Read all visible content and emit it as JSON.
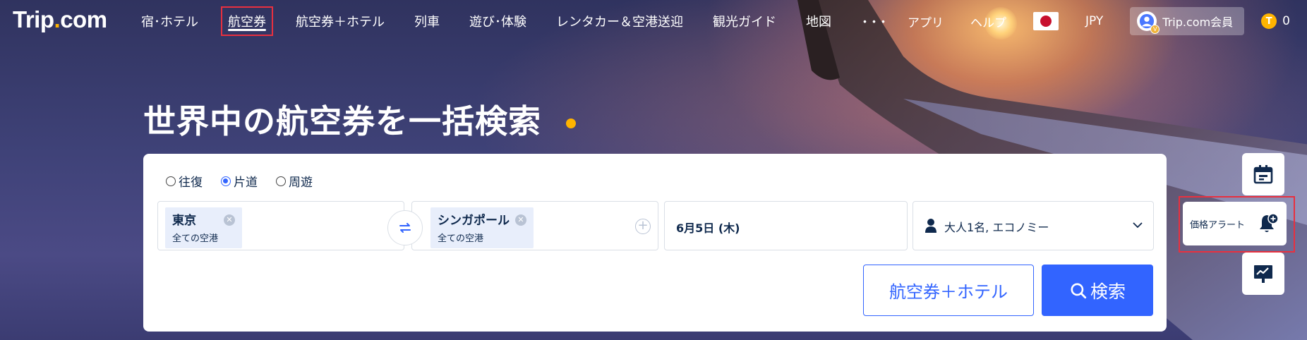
{
  "brand": {
    "logo_main": "Trip",
    "logo_dot": ".",
    "logo_tail": "com"
  },
  "nav": {
    "items": [
      {
        "label": "宿･ホテル"
      },
      {
        "label": "航空券",
        "active": true
      },
      {
        "label": "航空券＋ホテル"
      },
      {
        "label": "列車"
      },
      {
        "label": "遊び･体験"
      },
      {
        "label": "レンタカー＆空港送迎"
      },
      {
        "label": "観光ガイド"
      },
      {
        "label": "地図"
      }
    ],
    "more": "･･･"
  },
  "header_tools": {
    "app": "アプリ",
    "help": "ヘルプ",
    "currency": "JPY",
    "member": "Trip.com会員",
    "coin_letter": "T",
    "coin_count": "0"
  },
  "hero": {
    "title": "世界中の航空券を一括検索"
  },
  "search": {
    "trip_types": [
      {
        "label": "往復",
        "checked": false
      },
      {
        "label": "片道",
        "checked": true
      },
      {
        "label": "周遊",
        "checked": false
      }
    ],
    "from": {
      "city": "東京",
      "sub": "全ての空港"
    },
    "to": {
      "city": "シンガポール",
      "sub": "全ての空港"
    },
    "date": "6月5日 (木)",
    "passengers": "大人1名, エコノミー",
    "bundle_button": "航空券＋ホテル",
    "search_button": "検索"
  },
  "side_widgets": {
    "price_alert": "価格アラート"
  },
  "colors": {
    "accent": "#3264ff",
    "highlight_frame": "#e8303f",
    "gold": "#ffb400",
    "text_dark": "#0f294d"
  }
}
